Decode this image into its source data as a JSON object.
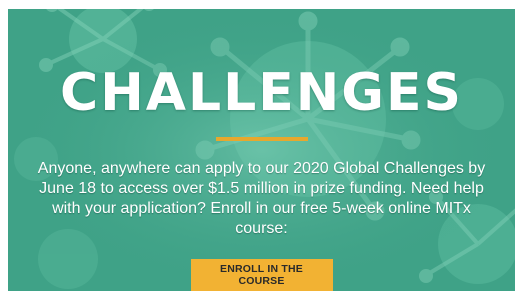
{
  "hero": {
    "headline": "CHALLENGES",
    "body": "Anyone, anywhere can apply to our 2020 Global Challenges by June 18 to access over $1.5 million in prize funding. Need help with your application? Enroll in our free 5-week online MITx course:",
    "cta_label": "ENROLL IN THE COURSE"
  },
  "colors": {
    "background": "#3fa287",
    "accent": "#e7a82e",
    "button": "#f2b233",
    "text": "#ffffff"
  }
}
